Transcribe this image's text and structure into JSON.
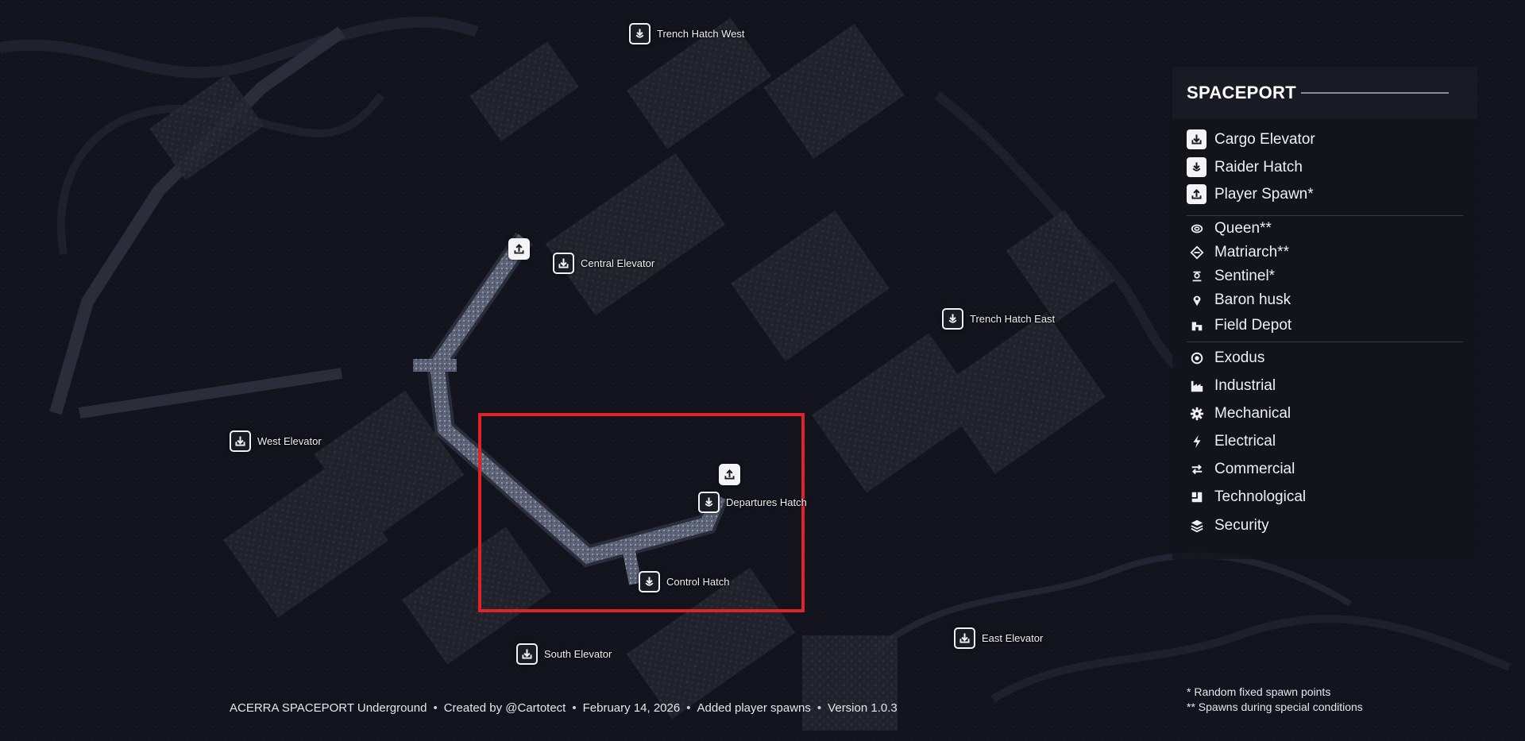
{
  "map_labels": {
    "trench_hatch_west": "Trench Hatch West",
    "central_elevator": "Central Elevator",
    "trench_hatch_east": "Trench Hatch East",
    "west_elevator": "West  Elevator",
    "departures_hatch": "Departures Hatch",
    "control_hatch": "Control Hatch",
    "south_elevator": "South Elevator",
    "east_elevator": "East Elevator"
  },
  "legend": {
    "title": "SPACEPORT",
    "spawn_items": [
      {
        "label": "Cargo Elevator",
        "icon": "cargo-elevator-icon"
      },
      {
        "label": "Raider Hatch",
        "icon": "raider-hatch-icon"
      },
      {
        "label": "Player Spawn*",
        "icon": "player-spawn-icon"
      }
    ],
    "enemy_items": [
      {
        "label": "Queen**",
        "icon": "queen-icon"
      },
      {
        "label": "Matriarch**",
        "icon": "matriarch-icon"
      },
      {
        "label": "Sentinel*",
        "icon": "sentinel-icon"
      },
      {
        "label": "Baron husk",
        "icon": "pin-icon"
      },
      {
        "label": "Field Depot",
        "icon": "depot-icon"
      }
    ],
    "loot_items": [
      {
        "label": "Exodus",
        "icon": "exodus-icon"
      },
      {
        "label": "Industrial",
        "icon": "factory-icon"
      },
      {
        "label": "Mechanical",
        "icon": "gear-icon"
      },
      {
        "label": "Electrical",
        "icon": "lightning-icon"
      },
      {
        "label": "Commercial",
        "icon": "exchange-icon"
      },
      {
        "label": "Technological",
        "icon": "chip-icon"
      },
      {
        "label": "Security",
        "icon": "layers-icon"
      }
    ]
  },
  "notes": {
    "line1": "* Random fixed spawn points",
    "line2": "** Spawns during special conditions"
  },
  "footer": {
    "map_name": "ACERRA SPACEPORT Underground",
    "credit": "Created by @Cartotect",
    "date": "February 14, 2026",
    "update": "Added player spawns",
    "version": "Version 1.0.3"
  },
  "colors": {
    "highlight": "#e0222a",
    "background": "#0b0c14",
    "marker": "#f4f4f6"
  }
}
